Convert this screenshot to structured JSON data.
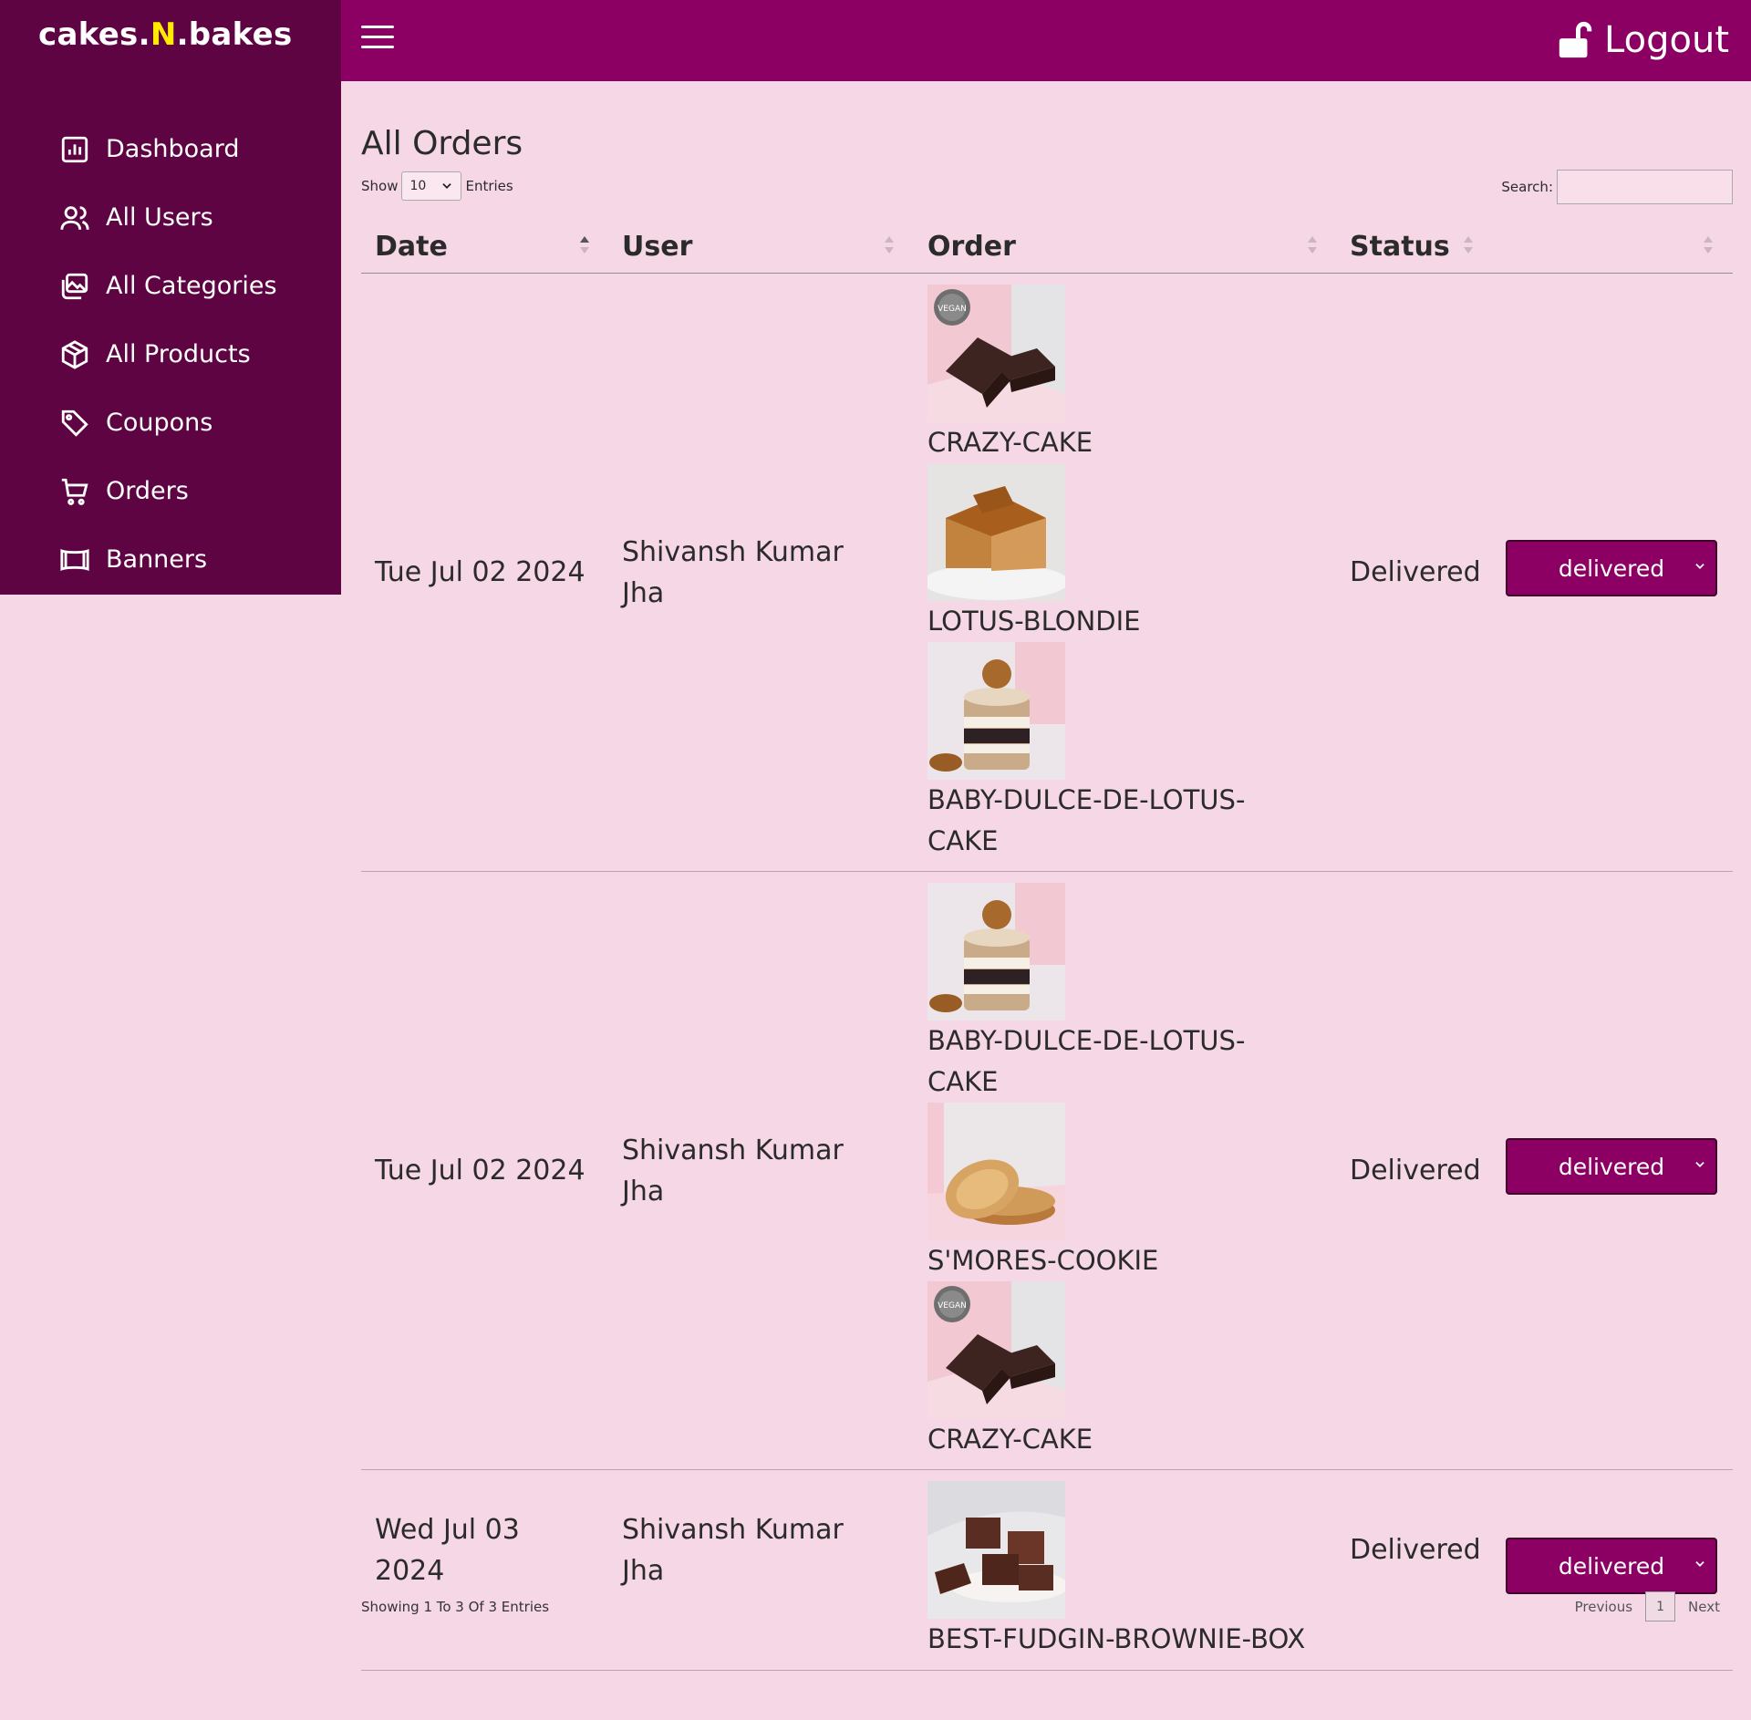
{
  "brand": {
    "pre": "cakes.",
    "n": "N",
    "post": ".bakes"
  },
  "sidebar": {
    "items": [
      {
        "label": "Dashboard"
      },
      {
        "label": "All Users"
      },
      {
        "label": "All Categories"
      },
      {
        "label": "All Products"
      },
      {
        "label": "Coupons"
      },
      {
        "label": "Orders"
      },
      {
        "label": "Banners"
      }
    ]
  },
  "header": {
    "logout": "Logout"
  },
  "page": {
    "title": "All Orders"
  },
  "controls": {
    "show": "Show",
    "entries_value": "10",
    "entries": "Entries",
    "search": "Search:"
  },
  "table": {
    "headers": {
      "date": "Date",
      "user": "User",
      "order": "Order",
      "status": "Status"
    },
    "rows": [
      {
        "date": "Tue Jul 02 2024",
        "user": "Shivansh Kumar Jha",
        "products": [
          "CRAZY-CAKE",
          "LOTUS-BLONDIE",
          "BABY-DULCE-DE-LOTUS-CAKE"
        ],
        "status": "Delivered",
        "select": "delivered"
      },
      {
        "date": "Tue Jul 02 2024",
        "user": "Shivansh Kumar Jha",
        "products": [
          "BABY-DULCE-DE-LOTUS-CAKE",
          "S'MORES-COOKIE",
          "CRAZY-CAKE"
        ],
        "status": "Delivered",
        "select": "delivered"
      },
      {
        "date": "Wed Jul 03 2024",
        "user": "Shivansh Kumar Jha",
        "products": [
          "BEST-FUDGIN-BROWNIE-BOX"
        ],
        "status": "Delivered",
        "select": "delivered"
      }
    ]
  },
  "footer": {
    "info": "Showing 1 To 3 Of 3 Entries",
    "previous": "Previous",
    "page": "1",
    "next": "Next"
  }
}
